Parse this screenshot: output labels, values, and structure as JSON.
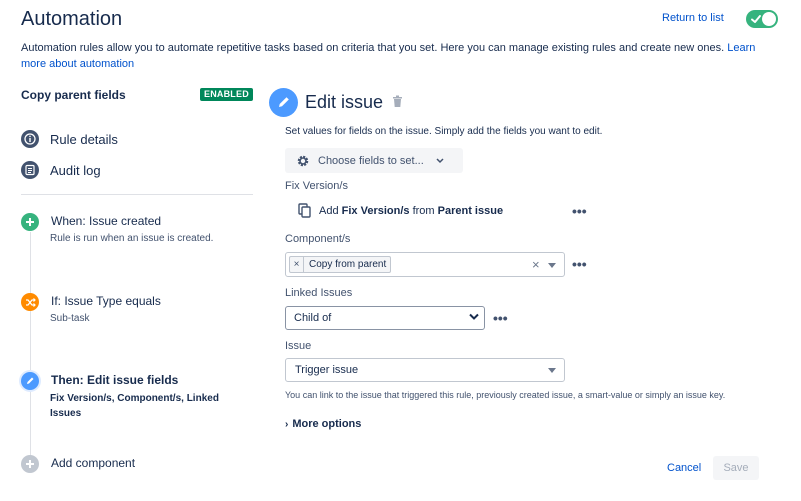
{
  "header": {
    "title": "Automation",
    "return_link": "Return to list",
    "intro_text": "Automation rules allow you to automate repetitive tasks based on criteria that you set. Here you can manage existing rules and create new ones. ",
    "intro_link": "Learn more about automation",
    "rule_enabled": true,
    "toggle_color": "#36b37e"
  },
  "sidebar": {
    "rule_name": "Copy parent fields",
    "status_badge": "ENABLED",
    "links": [
      {
        "label": "Rule details",
        "icon": "info-icon"
      },
      {
        "label": "Audit log",
        "icon": "list-icon"
      }
    ],
    "steps": [
      {
        "title": "When: Issue created",
        "subtitle": "Rule is run when an issue is created.",
        "icon": "plus-icon",
        "color": "#36b37e"
      },
      {
        "title": "If: Issue Type equals",
        "subtitle": "Sub-task",
        "icon": "shuffle-icon",
        "color": "#ff8b00"
      },
      {
        "title": "Then: Edit issue fields",
        "subtitle": "Fix Version/s, Component/s, Linked Issues",
        "icon": "pencil-icon",
        "color": "#4c9aff"
      }
    ],
    "add_component": "Add component"
  },
  "editor": {
    "title": "Edit issue",
    "description": "Set values for fields on the issue. Simply add the fields you want to edit.",
    "choose_fields": "Choose fields to set...",
    "fields": {
      "fix_version": {
        "label": "Fix Version/s",
        "copy_prefix": "Add ",
        "copy_field": "Fix Version/s",
        "copy_middle": " from ",
        "copy_source": "Parent issue"
      },
      "components": {
        "label": "Component/s",
        "chip": "Copy from parent"
      },
      "linked_issues": {
        "label": "Linked Issues",
        "selected": "Child of"
      },
      "issue": {
        "label": "Issue",
        "selected": "Trigger issue",
        "help": "You can link to the issue that triggered this rule, previously created issue, a smart-value or simply an issue key."
      }
    },
    "more_options": "More options",
    "cancel": "Cancel",
    "save": "Save"
  }
}
